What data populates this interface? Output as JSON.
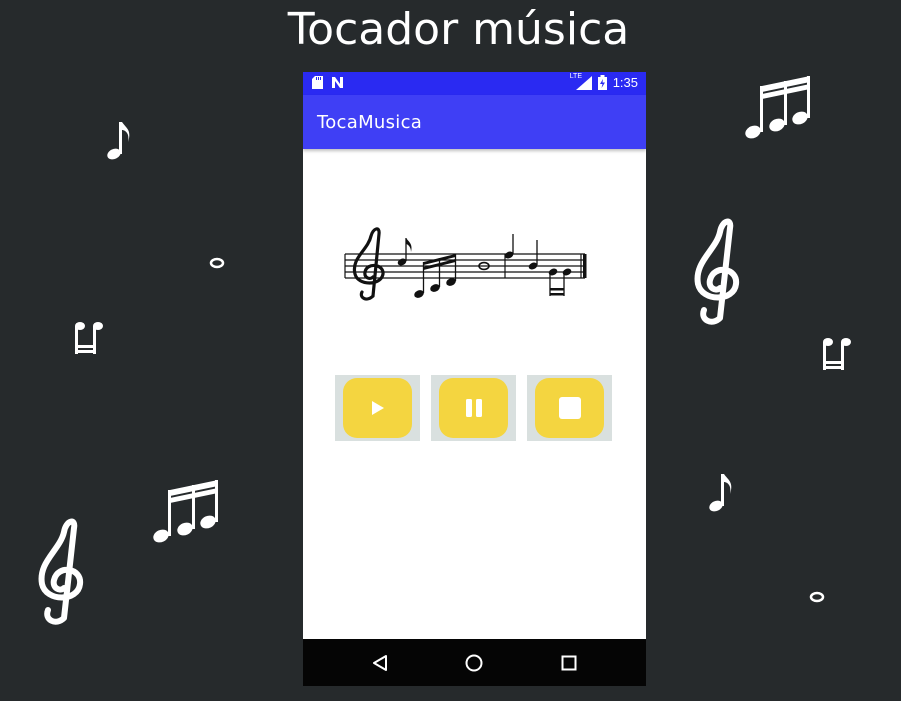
{
  "page": {
    "title": "Tocador música",
    "background": "#262a2c"
  },
  "status_bar": {
    "network": "LTE",
    "time": "1:35",
    "color": "#2a2af2"
  },
  "app_bar": {
    "title": "TocaMusica",
    "color": "#3f3ff5"
  },
  "controls": [
    {
      "name": "play-button",
      "icon": "play-icon"
    },
    {
      "name": "pause-button",
      "icon": "pause-icon"
    },
    {
      "name": "stop-button",
      "icon": "stop-icon"
    }
  ],
  "control_colors": {
    "outer": "#d9e0df",
    "inner": "#f4d540"
  },
  "nav_bar": [
    {
      "name": "back-button",
      "icon": "back-triangle-icon"
    },
    {
      "name": "home-button",
      "icon": "home-circle-icon"
    },
    {
      "name": "recents-button",
      "icon": "recents-square-icon"
    }
  ]
}
